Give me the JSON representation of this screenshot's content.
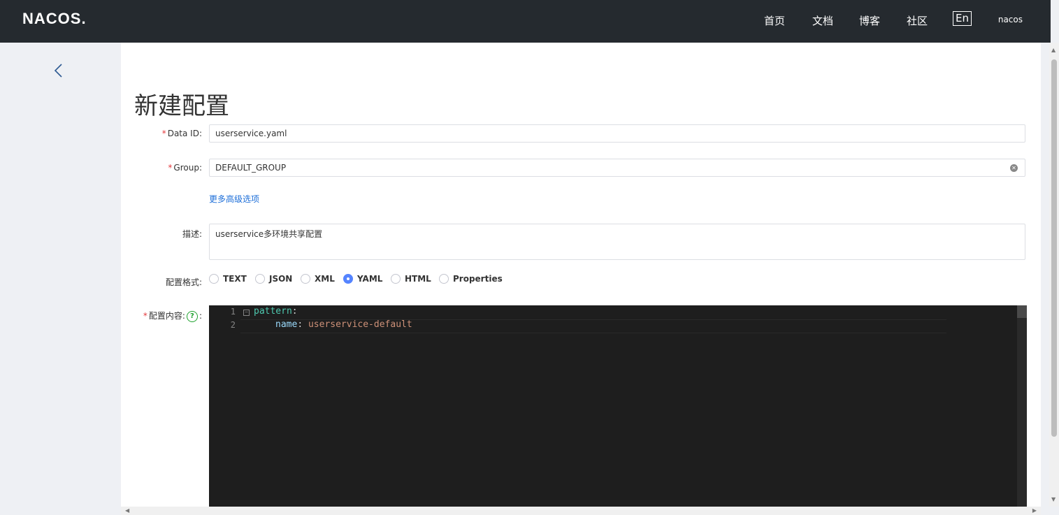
{
  "header": {
    "logo": "NACOS.",
    "nav": [
      "首页",
      "文档",
      "博客",
      "社区"
    ],
    "lang_button": "En",
    "user": "nacos"
  },
  "page": {
    "title": "新建配置"
  },
  "form": {
    "data_id": {
      "label": "Data ID:",
      "value": "userservice.yaml"
    },
    "group": {
      "label": "Group:",
      "value": "DEFAULT_GROUP"
    },
    "advanced_link": "更多高级选项",
    "description": {
      "label": "描述:",
      "value": "userservice多环境共享配置"
    },
    "format": {
      "label": "配置格式:",
      "options": [
        "TEXT",
        "JSON",
        "XML",
        "YAML",
        "HTML",
        "Properties"
      ],
      "selected": "YAML"
    },
    "content": {
      "label": "配置内容:",
      "help_icon": "?",
      "colon": ":",
      "lines": [
        {
          "num": "1",
          "key": "pattern",
          "punct": ":",
          "value": ""
        },
        {
          "num": "2",
          "key": "name",
          "punct": ":",
          "value": "userservice-default"
        }
      ]
    }
  },
  "colors": {
    "topbar": "#252a2f",
    "accent": "#5584ff",
    "link": "#1e6fd9",
    "required": "#e4393c",
    "editor_bg": "#1e1e1e"
  },
  "icons": {
    "back": "chevron-left-icon",
    "clear": "clear-icon",
    "help": "help-icon"
  }
}
